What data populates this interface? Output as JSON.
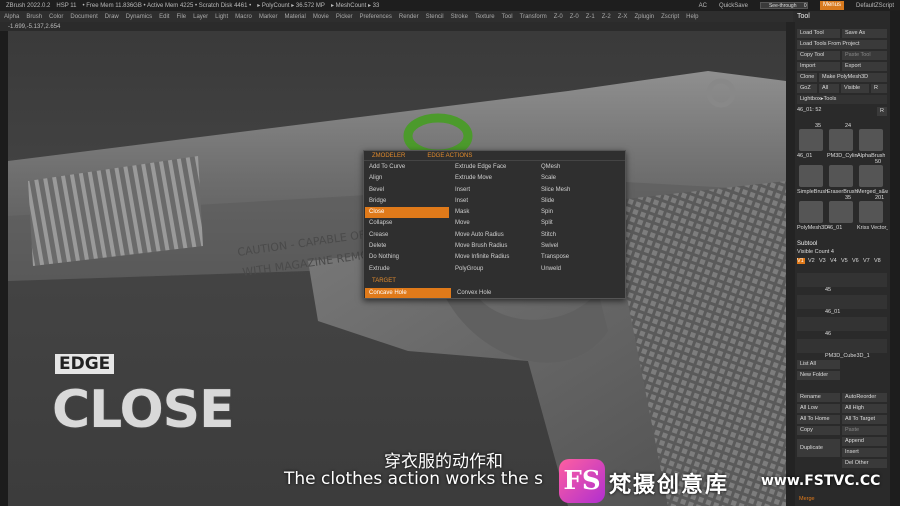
{
  "titlebar": {
    "app": "ZBrush 2022.0.2",
    "hsp": "HSP 11",
    "free_mem": "• Free Mem 11.836GB • Active Mem 4225 • Scratch Disk 4461 •",
    "polycount": "▸ PolyCount ▸ 36.572 MP",
    "meshcount": "▸ MeshCount ▸ 33",
    "ac": "AC",
    "quicksave": "QuickSave",
    "seethrough": "See-through",
    "seethrough_value": "0",
    "menus": "Menus",
    "script": "DefaultZScript"
  },
  "menubar": [
    "Alpha",
    "Brush",
    "Color",
    "Document",
    "Draw",
    "Dynamics",
    "Edit",
    "File",
    "Layer",
    "Light",
    "Macro",
    "Marker",
    "Material",
    "Movie",
    "Picker",
    "Preferences",
    "Render",
    "Stencil",
    "Stroke",
    "Texture",
    "Tool",
    "Transform",
    "Z-0",
    "Z-0",
    "Z-1",
    "Z-2",
    "Z-X",
    "Zplugin",
    "Zscript",
    "Help"
  ],
  "coords": "-1.699,-5.137,2.654",
  "overlay": {
    "edge": "EDGE",
    "close": "CLOSE"
  },
  "popup": {
    "header_left": "ZMODELER",
    "header_right": "EDGE ACTIONS",
    "col1": [
      "Add To Curve",
      "Align",
      "Bevel",
      "Bridge",
      "Close",
      "Collapse",
      "Crease",
      "Delete",
      "Do Nothing",
      "Extrude"
    ],
    "col2": [
      "Extrude Edge Face",
      "Extrude Move",
      "Insert",
      "Inset",
      "Mask",
      "Move",
      "Move Auto Radius",
      "Move Brush Radius",
      "Move Infinite Radius",
      "PolyGroup"
    ],
    "col3": [
      "QMesh",
      "Scale",
      "Slice Mesh",
      "Slide",
      "Spin",
      "Split",
      "Stitch",
      "Swivel",
      "Transpose",
      "Unweld"
    ],
    "active_item": "Close",
    "target_label": "TARGET",
    "target_options": [
      "Concave Hole",
      "Convex Hole"
    ],
    "target_active": "Concave Hole"
  },
  "panel": {
    "title": "Tool",
    "buttons": {
      "load_tool": "Load Tool",
      "save_as": "Save As",
      "load_from_project": "Load Tools From Project",
      "copy_tool": "Copy Tool",
      "paste_tool": "Paste Tool",
      "import": "Import",
      "export": "Export",
      "clone": "Clone",
      "make_polymesh": "Make PolyMesh3D",
      "goz": "GoZ",
      "all": "All",
      "visible": "Visible",
      "r": "R",
      "lightbox": "Lightbox▸Tools",
      "list_all": "List All",
      "new_folder": "New Folder",
      "rename": "Rename",
      "autoreorder": "AutoReorder",
      "all_low": "All Low",
      "all_high": "All High",
      "all_to_home": "All To Home",
      "all_to_target": "All To Target",
      "copy": "Copy",
      "paste": "Paste",
      "duplicate": "Duplicate",
      "append": "Append",
      "insert": "Insert",
      "del_other": "Del Other",
      "merge": "Merge"
    },
    "current_tool": "46_01: 52",
    "tools": [
      {
        "label": "46_01",
        "count": "35"
      },
      {
        "label": "PM3D_Cylinder3",
        "count": "24"
      },
      {
        "label": "AlphaBrush",
        "count": ""
      },
      {
        "label": "SimpleBrush",
        "count": ""
      },
      {
        "label": "EraserBrush",
        "count": ""
      },
      {
        "label": "Merged_s&w",
        "count": "50"
      },
      {
        "label": "PolyMesh3D",
        "count": ""
      },
      {
        "label": "46_01",
        "count": "35"
      },
      {
        "label": "Kriss Vector_24",
        "count": "201"
      }
    ],
    "subtool_label": "Subtool",
    "visible_count": "Visible Count 4",
    "versions": [
      "V1",
      "V2",
      "V3",
      "V4",
      "V5",
      "V6",
      "V7",
      "V8"
    ],
    "subtool_items": [
      "45",
      "46_01",
      "46",
      "PM3D_Cube3D_1"
    ]
  },
  "subtitles": {
    "cn": "穿衣服的动作和",
    "en": "The clothes action works the s"
  },
  "watermark": {
    "logo": "FS",
    "cn": "梵摄创意库",
    "url": "www.FSTVC.CC"
  },
  "colors": {
    "accent": "#e07a1a",
    "panel_bg": "#2a2a2a",
    "viewport_bg": "#404040"
  }
}
